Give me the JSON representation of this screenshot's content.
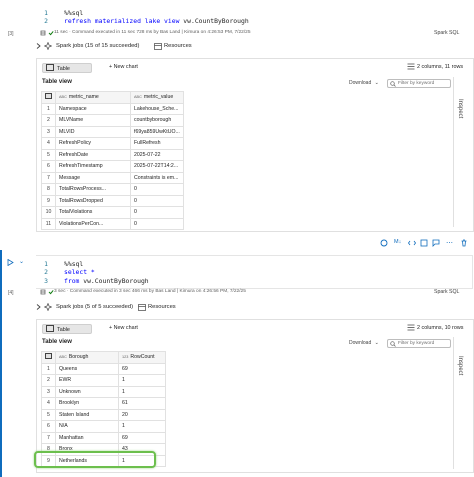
{
  "cell1": {
    "lines": [
      "1",
      "2"
    ],
    "code_line1": "%%sql",
    "code_line2_kw": "refresh materialized lake view",
    "code_line2_rest": " vw.CountByBorough",
    "index": "[3]",
    "status": "11 sec · Command executed in 11 sec 728 ms by Bas Land | Kimura on 4:26:53 PM, 7/22/25",
    "lang": "Spark SQL",
    "spark_jobs": "Spark jobs (15 of 15 succeeded)",
    "resources": "Resources",
    "tabs": {
      "table": "Table",
      "new_chart": "+ New chart"
    },
    "summary": "2 columns, 11 rows",
    "table_view": "Table view",
    "download": "Download",
    "filter_placeholder": "Filter by keyword",
    "inspect": "Inspect",
    "columns": [
      "metric_name",
      "metric_value"
    ],
    "column_types": [
      "ABC",
      "ABC"
    ],
    "rows": [
      [
        "1",
        "Namespace",
        "Lakehouse_Sche..."
      ],
      [
        "2",
        "MLVName",
        "countbyborough"
      ],
      [
        "3",
        "MLVID",
        "f69ya859UwKtUO..."
      ],
      [
        "4",
        "RefreshPolicy",
        "FullRefresh"
      ],
      [
        "5",
        "RefreshDate",
        "2025-07-22"
      ],
      [
        "6",
        "RefreshTimestamp",
        "2025-07-22T14:2..."
      ],
      [
        "7",
        "Message",
        "Constraints is em..."
      ],
      [
        "8",
        "TotalRowsProcess...",
        "0"
      ],
      [
        "9",
        "TotalRowsDropped",
        "0"
      ],
      [
        "10",
        "TotalViolations",
        "0"
      ],
      [
        "11",
        "ViolationsPerCon...",
        "0"
      ]
    ]
  },
  "cell2": {
    "lines": [
      "1",
      "2",
      "3"
    ],
    "code_line1": "%%sql",
    "code_line2": "select *",
    "code_line3_kw": "from",
    "code_line3_rest": " vw.CountByBorough",
    "index": "[4]",
    "status": "3 sec · Command executed in 3 sec 466 ms by Bas Land | Kimura on 4:26:56 PM, 7/22/25",
    "lang": "Spark SQL",
    "spark_jobs": "Spark jobs (5 of 5 succeeded)",
    "resources": "Resources",
    "tabs": {
      "table": "Table",
      "new_chart": "+ New chart"
    },
    "summary": "2 columns, 10 rows",
    "table_view": "Table view",
    "download": "Download",
    "filter_placeholder": "Filter by keyword",
    "inspect": "Inspect",
    "columns": [
      "Borough",
      "RowCount"
    ],
    "column_types": [
      "ABC",
      "123"
    ],
    "rows": [
      [
        "1",
        "Queens",
        "69"
      ],
      [
        "2",
        "EWR",
        "1"
      ],
      [
        "3",
        "Unknown",
        "1"
      ],
      [
        "4",
        "Brooklyn",
        "61"
      ],
      [
        "5",
        "Staten Island",
        "20"
      ],
      [
        "6",
        "N/A",
        "1"
      ],
      [
        "7",
        "Manhattan",
        "69"
      ],
      [
        "8",
        "Bronx",
        "43"
      ],
      [
        "9",
        "Netherlands",
        "1"
      ]
    ]
  },
  "colors": {
    "accent": "#0f6cbd",
    "highlight": "#6cbf4d",
    "keyword": "#0000ff"
  }
}
